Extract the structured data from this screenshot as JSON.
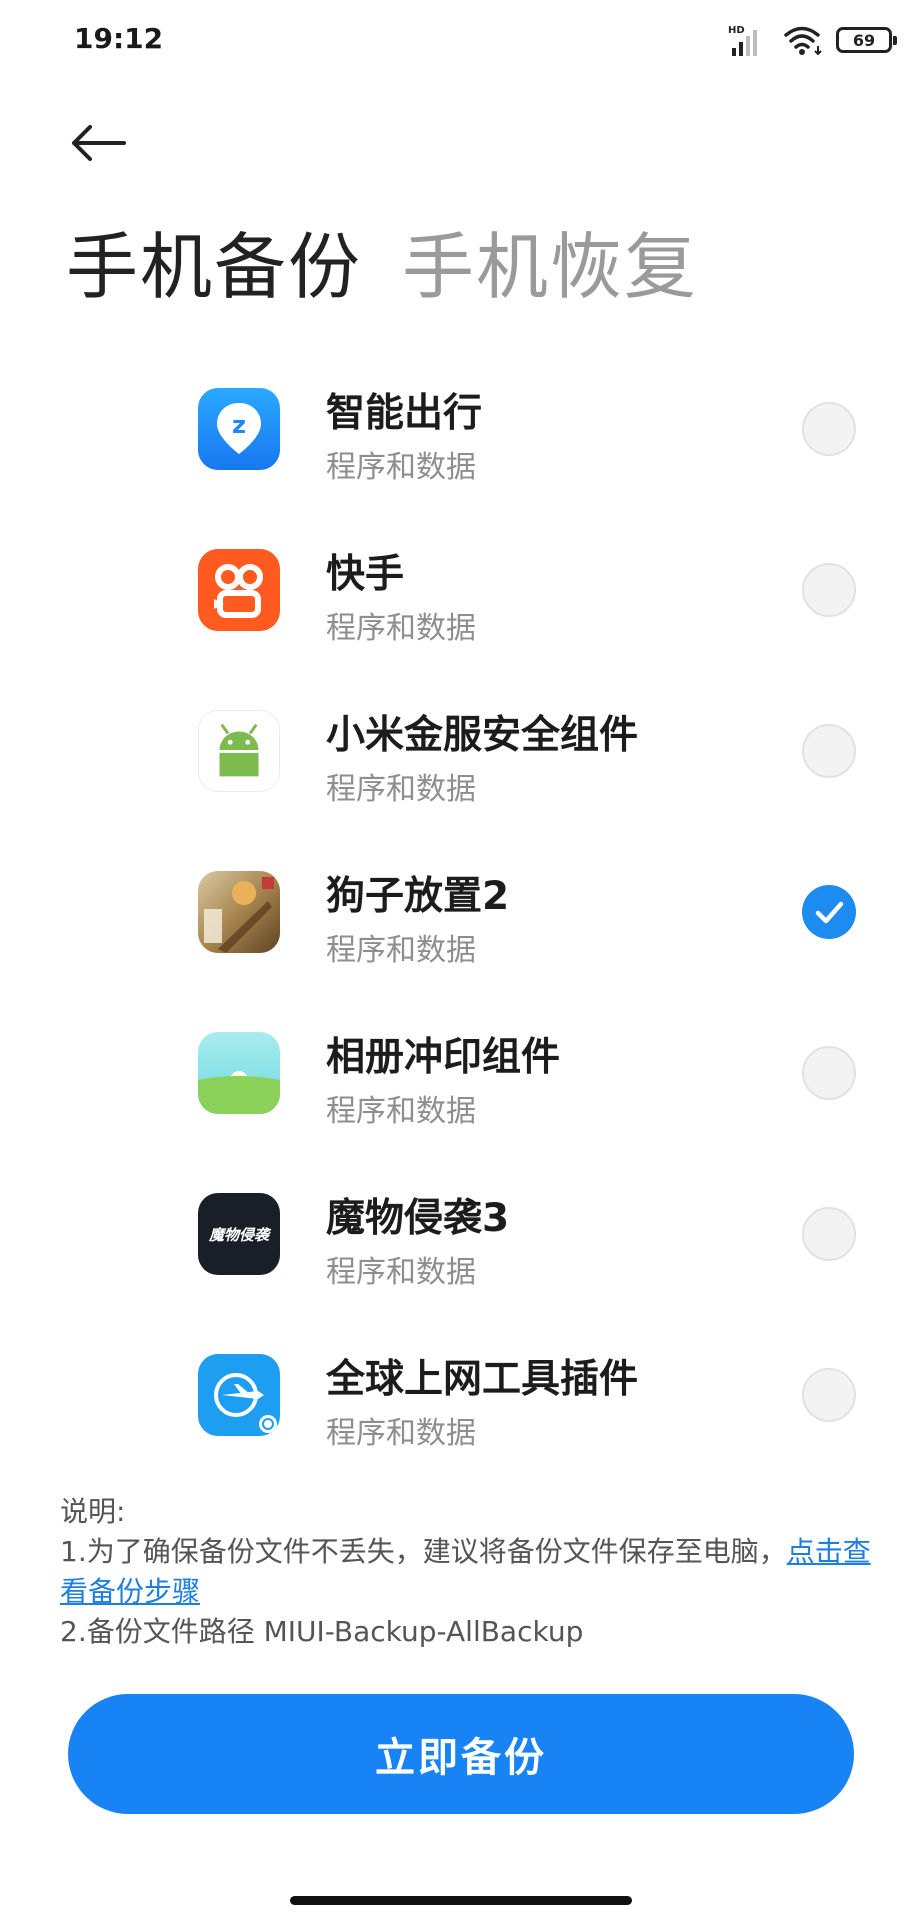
{
  "status_bar": {
    "time": "19:12",
    "battery": "69",
    "network_label": "HD"
  },
  "tabs": [
    {
      "label": "手机备份",
      "active": true
    },
    {
      "label": "手机恢复",
      "active": false
    }
  ],
  "apps": [
    {
      "name": "智能出行",
      "subtitle": "程序和数据",
      "icon": "location-pin-icon",
      "selected": false
    },
    {
      "name": "快手",
      "subtitle": "程序和数据",
      "icon": "kuaishou-icon",
      "selected": false
    },
    {
      "name": "小米金服安全组件",
      "subtitle": "程序和数据",
      "icon": "android-icon",
      "selected": false
    },
    {
      "name": "狗子放置2",
      "subtitle": "程序和数据",
      "icon": "game-art-icon",
      "selected": true
    },
    {
      "name": "相册冲印组件",
      "subtitle": "程序和数据",
      "icon": "landscape-icon",
      "selected": false
    },
    {
      "name": "魔物侵袭3",
      "subtitle": "程序和数据",
      "icon": "calligraphy-icon",
      "selected": false,
      "icon_text": "魔物侵袭"
    },
    {
      "name": "全球上网工具插件",
      "subtitle": "程序和数据",
      "icon": "airplane-globe-icon",
      "selected": false
    }
  ],
  "notes": {
    "heading": "说明:",
    "line1": "1.为了确保备份文件不丢失，建议将备份文件保存至电脑，",
    "link": "点击查看备份步骤",
    "line2": "2.备份文件路径 MIUI-Backup-AllBackup"
  },
  "primary_button": {
    "label": "立即备份"
  },
  "colors": {
    "accent": "#1883f5",
    "inactive_text": "#9a9a9a",
    "subtitle_text": "#8e8e8e"
  }
}
